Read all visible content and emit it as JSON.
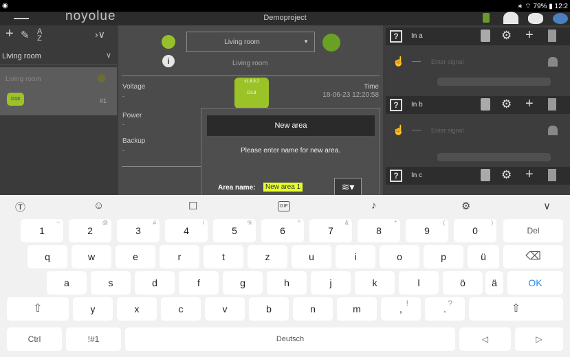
{
  "status": {
    "right": "∗ ⌔ 79% ▮ 12:2"
  },
  "app": {
    "title": "Demoproject",
    "logo": "noyolue"
  },
  "left_panel": {
    "room_header": "Living room",
    "selected_room": "Living room",
    "device_badge": "D13",
    "device_num": "#1"
  },
  "middle": {
    "room_dropdown": "Living room",
    "room_info": "Living room",
    "voltage_label": "Voltage",
    "voltage_value": "-",
    "time_label": "Time",
    "time_value": "18-06-23 12:20:58",
    "power_label": "Power",
    "power_value": "-",
    "backup_label": "Backup",
    "backup_value": "-",
    "device_version": "v1.8.9.2",
    "device_name": "D13"
  },
  "right": {
    "in_a": "In a",
    "in_b": "In b",
    "in_c": "In c",
    "signal_placeholder": "Enter signal",
    "dash": "—"
  },
  "dialog": {
    "title": "New area",
    "message": "Please enter name for new area.",
    "field_label": "Area name:",
    "field_value": "New area 1"
  },
  "keyboard": {
    "row1": [
      {
        "k": "1",
        "s": "~"
      },
      {
        "k": "2",
        "s": "@"
      },
      {
        "k": "3",
        "s": "#"
      },
      {
        "k": "4",
        "s": "/"
      },
      {
        "k": "5",
        "s": "%"
      },
      {
        "k": "6",
        "s": "^"
      },
      {
        "k": "7",
        "s": "&"
      },
      {
        "k": "8",
        "s": "*"
      },
      {
        "k": "9",
        "s": "("
      },
      {
        "k": "0",
        "s": ")"
      }
    ],
    "del": "Del",
    "row2": [
      "q",
      "w",
      "e",
      "r",
      "t",
      "z",
      "u",
      "i",
      "o",
      "p",
      "ü"
    ],
    "row3": [
      "a",
      "s",
      "d",
      "f",
      "g",
      "h",
      "j",
      "k",
      "l",
      "ö",
      "ä"
    ],
    "ok": "OK",
    "row4": [
      "y",
      "x",
      "c",
      "v",
      "b",
      "n",
      "m"
    ],
    "comma": ",",
    "comma_sub": "!",
    "period": ".",
    "period_sub": "?",
    "ctrl": "Ctrl",
    "sym": "!#1",
    "space": "Deutsch",
    "gif": "GIF"
  }
}
